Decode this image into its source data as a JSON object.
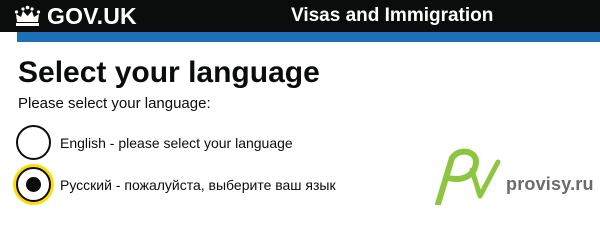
{
  "header": {
    "logo_text": "GOV.UK",
    "service_name": "Visas and Immigration"
  },
  "main": {
    "title": "Select your language",
    "hint": "Please select your language:",
    "options": [
      {
        "label": "English - please select your language",
        "checked": false
      },
      {
        "label": "Русский - пожалуйста, выберите ваш язык",
        "checked": true
      }
    ]
  },
  "watermark": {
    "text": "provisy.ru"
  },
  "colors": {
    "header_bg": "#0b0c0c",
    "accent_blue": "#1d70b8",
    "focus_yellow": "#ffdd00",
    "text": "#0b0c0c"
  }
}
